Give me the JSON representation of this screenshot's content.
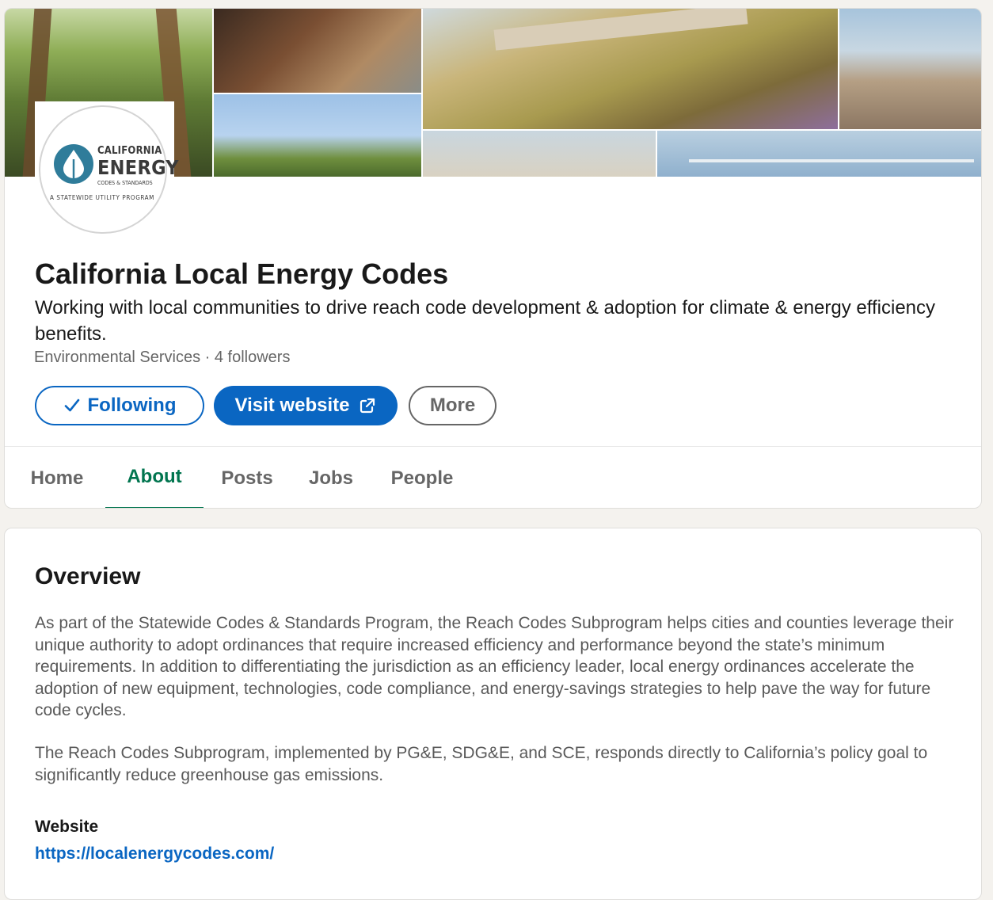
{
  "company": {
    "name": "California Local Energy Codes",
    "tagline": "Working with local communities to drive reach code development & adoption for climate & energy efficiency benefits.",
    "meta": "Environmental Services · 4 followers"
  },
  "logo": {
    "line1": "CALIFORNIA",
    "line2": "ENERGY",
    "line3": "CODES & STANDARDS",
    "line4": "A STATEWIDE UTILITY PROGRAM"
  },
  "buttons": {
    "following": "Following",
    "visit_website": "Visit website",
    "more": "More"
  },
  "tabs": [
    {
      "label": "Home",
      "active": false
    },
    {
      "label": "About",
      "active": true
    },
    {
      "label": "Posts",
      "active": false
    },
    {
      "label": "Jobs",
      "active": false
    },
    {
      "label": "People",
      "active": false
    }
  ],
  "about": {
    "title": "Overview",
    "paragraphs": [
      "As part of the Statewide Codes & Standards Program, the Reach Codes Subprogram helps cities and counties leverage their unique authority to adopt ordinances that require increased efficiency and performance beyond the state’s minimum requirements. In addition to differentiating the jurisdiction as an efficiency leader, local energy ordinances accelerate the adoption of new equipment, technologies, code compliance, and energy-savings strategies to help pave the way for future code cycles.",
      "The Reach Codes Subprogram, implemented by PG&E, SDG&E, and SCE, responds directly to California’s policy goal to significantly reduce greenhouse gas emissions."
    ],
    "website_label": "Website",
    "website_url": "https://localenergycodes.com/"
  },
  "colors": {
    "primary": "#0a66c2",
    "active_tab": "#01754f",
    "background": "#f4f2ee",
    "muted_text": "#666666",
    "logo_teal": "#2f7c9a"
  },
  "icons": {
    "check": "check-icon",
    "external_link": "external-link-icon",
    "logo_mark": "leaf-drop-icon"
  }
}
